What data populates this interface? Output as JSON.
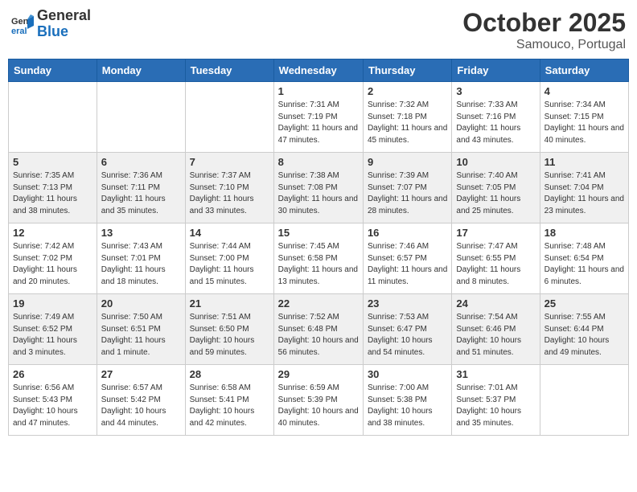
{
  "header": {
    "logo_general": "General",
    "logo_blue": "Blue",
    "month_title": "October 2025",
    "subtitle": "Samouco, Portugal"
  },
  "days_of_week": [
    "Sunday",
    "Monday",
    "Tuesday",
    "Wednesday",
    "Thursday",
    "Friday",
    "Saturday"
  ],
  "weeks": [
    [
      {
        "day": "",
        "info": ""
      },
      {
        "day": "",
        "info": ""
      },
      {
        "day": "",
        "info": ""
      },
      {
        "day": "1",
        "info": "Sunrise: 7:31 AM\nSunset: 7:19 PM\nDaylight: 11 hours and 47 minutes."
      },
      {
        "day": "2",
        "info": "Sunrise: 7:32 AM\nSunset: 7:18 PM\nDaylight: 11 hours and 45 minutes."
      },
      {
        "day": "3",
        "info": "Sunrise: 7:33 AM\nSunset: 7:16 PM\nDaylight: 11 hours and 43 minutes."
      },
      {
        "day": "4",
        "info": "Sunrise: 7:34 AM\nSunset: 7:15 PM\nDaylight: 11 hours and 40 minutes."
      }
    ],
    [
      {
        "day": "5",
        "info": "Sunrise: 7:35 AM\nSunset: 7:13 PM\nDaylight: 11 hours and 38 minutes."
      },
      {
        "day": "6",
        "info": "Sunrise: 7:36 AM\nSunset: 7:11 PM\nDaylight: 11 hours and 35 minutes."
      },
      {
        "day": "7",
        "info": "Sunrise: 7:37 AM\nSunset: 7:10 PM\nDaylight: 11 hours and 33 minutes."
      },
      {
        "day": "8",
        "info": "Sunrise: 7:38 AM\nSunset: 7:08 PM\nDaylight: 11 hours and 30 minutes."
      },
      {
        "day": "9",
        "info": "Sunrise: 7:39 AM\nSunset: 7:07 PM\nDaylight: 11 hours and 28 minutes."
      },
      {
        "day": "10",
        "info": "Sunrise: 7:40 AM\nSunset: 7:05 PM\nDaylight: 11 hours and 25 minutes."
      },
      {
        "day": "11",
        "info": "Sunrise: 7:41 AM\nSunset: 7:04 PM\nDaylight: 11 hours and 23 minutes."
      }
    ],
    [
      {
        "day": "12",
        "info": "Sunrise: 7:42 AM\nSunset: 7:02 PM\nDaylight: 11 hours and 20 minutes."
      },
      {
        "day": "13",
        "info": "Sunrise: 7:43 AM\nSunset: 7:01 PM\nDaylight: 11 hours and 18 minutes."
      },
      {
        "day": "14",
        "info": "Sunrise: 7:44 AM\nSunset: 7:00 PM\nDaylight: 11 hours and 15 minutes."
      },
      {
        "day": "15",
        "info": "Sunrise: 7:45 AM\nSunset: 6:58 PM\nDaylight: 11 hours and 13 minutes."
      },
      {
        "day": "16",
        "info": "Sunrise: 7:46 AM\nSunset: 6:57 PM\nDaylight: 11 hours and 11 minutes."
      },
      {
        "day": "17",
        "info": "Sunrise: 7:47 AM\nSunset: 6:55 PM\nDaylight: 11 hours and 8 minutes."
      },
      {
        "day": "18",
        "info": "Sunrise: 7:48 AM\nSunset: 6:54 PM\nDaylight: 11 hours and 6 minutes."
      }
    ],
    [
      {
        "day": "19",
        "info": "Sunrise: 7:49 AM\nSunset: 6:52 PM\nDaylight: 11 hours and 3 minutes."
      },
      {
        "day": "20",
        "info": "Sunrise: 7:50 AM\nSunset: 6:51 PM\nDaylight: 11 hours and 1 minute."
      },
      {
        "day": "21",
        "info": "Sunrise: 7:51 AM\nSunset: 6:50 PM\nDaylight: 10 hours and 59 minutes."
      },
      {
        "day": "22",
        "info": "Sunrise: 7:52 AM\nSunset: 6:48 PM\nDaylight: 10 hours and 56 minutes."
      },
      {
        "day": "23",
        "info": "Sunrise: 7:53 AM\nSunset: 6:47 PM\nDaylight: 10 hours and 54 minutes."
      },
      {
        "day": "24",
        "info": "Sunrise: 7:54 AM\nSunset: 6:46 PM\nDaylight: 10 hours and 51 minutes."
      },
      {
        "day": "25",
        "info": "Sunrise: 7:55 AM\nSunset: 6:44 PM\nDaylight: 10 hours and 49 minutes."
      }
    ],
    [
      {
        "day": "26",
        "info": "Sunrise: 6:56 AM\nSunset: 5:43 PM\nDaylight: 10 hours and 47 minutes."
      },
      {
        "day": "27",
        "info": "Sunrise: 6:57 AM\nSunset: 5:42 PM\nDaylight: 10 hours and 44 minutes."
      },
      {
        "day": "28",
        "info": "Sunrise: 6:58 AM\nSunset: 5:41 PM\nDaylight: 10 hours and 42 minutes."
      },
      {
        "day": "29",
        "info": "Sunrise: 6:59 AM\nSunset: 5:39 PM\nDaylight: 10 hours and 40 minutes."
      },
      {
        "day": "30",
        "info": "Sunrise: 7:00 AM\nSunset: 5:38 PM\nDaylight: 10 hours and 38 minutes."
      },
      {
        "day": "31",
        "info": "Sunrise: 7:01 AM\nSunset: 5:37 PM\nDaylight: 10 hours and 35 minutes."
      },
      {
        "day": "",
        "info": ""
      }
    ]
  ]
}
